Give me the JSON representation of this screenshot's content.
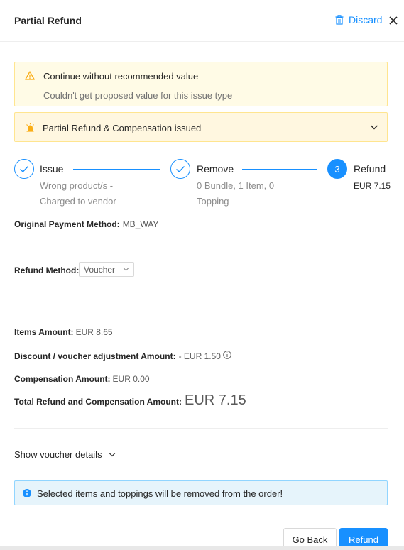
{
  "header": {
    "title": "Partial Refund",
    "discard_label": "Discard"
  },
  "warning": {
    "title": "Continue without recommended value",
    "subtitle": "Couldn't get proposed value for this issue type"
  },
  "compensation_banner": {
    "title": "Partial Refund & Compensation issued"
  },
  "steps": [
    {
      "title": "Issue",
      "desc_line1": "Wrong product/s -",
      "desc_line2": "Charged to vendor",
      "state": "done"
    },
    {
      "title": "Remove",
      "desc_line1": "0 Bundle, 1 Item, 0",
      "desc_line2": "Topping",
      "state": "done"
    },
    {
      "number": "3",
      "title": "Refund",
      "desc_line1": "EUR 7.15",
      "state": "active"
    }
  ],
  "payment": {
    "label": "Original Payment Method:",
    "value": "MB_WAY"
  },
  "refund_method": {
    "label": "Refund Method:",
    "selected": "Voucher"
  },
  "amounts": {
    "items_label": "Items Amount:",
    "items_value": "EUR 8.65",
    "discount_label": "Discount / voucher adjustment Amount:",
    "discount_value": "- EUR 1.50",
    "compensation_label": "Compensation Amount:",
    "compensation_value": "EUR 0.00",
    "total_label": "Total Refund and Compensation Amount:",
    "total_value": "EUR 7.15"
  },
  "voucher_toggle_label": "Show voucher details",
  "info_message": "Selected items and toppings will be removed from the order!",
  "buttons": {
    "back": "Go Back",
    "refund": "Refund"
  },
  "colors": {
    "primary": "#1890ff",
    "warning_bg": "#fffbe6",
    "warning_border": "#ffe58f",
    "warning_icon": "#faad14",
    "info_bg": "#e6f4fb",
    "info_border": "#91d5ff"
  }
}
